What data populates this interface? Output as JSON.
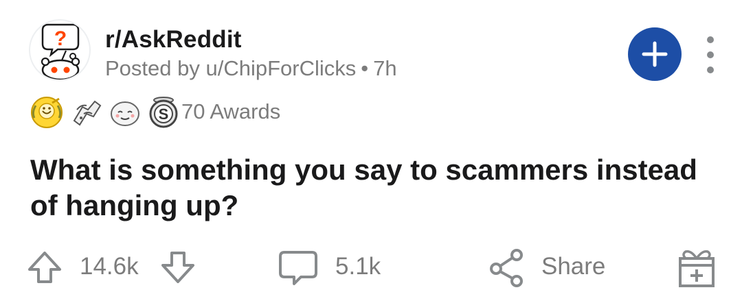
{
  "post": {
    "subreddit": "r/AskReddit",
    "posted_by": "Posted by u/ChipForClicks",
    "separator": "•",
    "age": "7h",
    "awards_count": "70 Awards",
    "title": "What is something you say to scammers instead of hanging up?",
    "score": "14.6k",
    "comments": "5.1k",
    "share_label": "Share"
  },
  "icons": {
    "avatar": "askreddit-snoo-icon",
    "join": "plus-icon",
    "more": "vertical-ellipsis-icon",
    "awards": [
      "helpful-award-icon",
      "hugz-award-icon",
      "wholesome-seal-award-icon",
      "silver-coin-award-icon"
    ],
    "upvote": "arrow-up-icon",
    "downvote": "arrow-down-icon",
    "comment": "comment-bubble-icon",
    "share": "share-icon",
    "gift": "gift-award-icon"
  },
  "colors": {
    "accent": "#1d4ea6",
    "text": "#1a1a1b",
    "muted": "#7c7c7c",
    "snoo_question": "#ff4500"
  }
}
